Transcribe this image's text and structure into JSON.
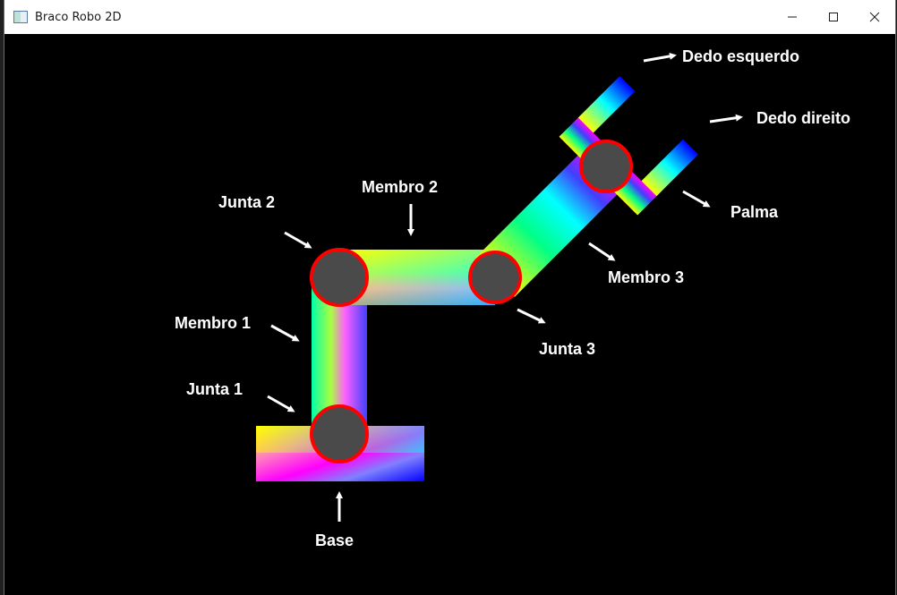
{
  "window": {
    "title": "Braco Robo 2D",
    "icon": "app-window-icon",
    "controls": [
      "minimize-icon",
      "maximize-icon",
      "close-icon"
    ]
  },
  "labels": {
    "dedo_esquerdo": "Dedo esquerdo",
    "dedo_direito": "Dedo direito",
    "palma": "Palma",
    "membro3": "Membro 3",
    "junta3": "Junta 3",
    "membro2": "Membro 2",
    "junta2": "Junta 2",
    "membro1": "Membro 1",
    "junta1": "Junta 1",
    "base": "Base"
  },
  "colors": {
    "background": "#000000",
    "joint_fill": "#4a4a4a",
    "joint_outline": "#ff0000",
    "label": "#ffffff",
    "gradient_stops": [
      "#ffff00",
      "#00ff88",
      "#00ffff",
      "#0000ff",
      "#ff00ff"
    ]
  }
}
